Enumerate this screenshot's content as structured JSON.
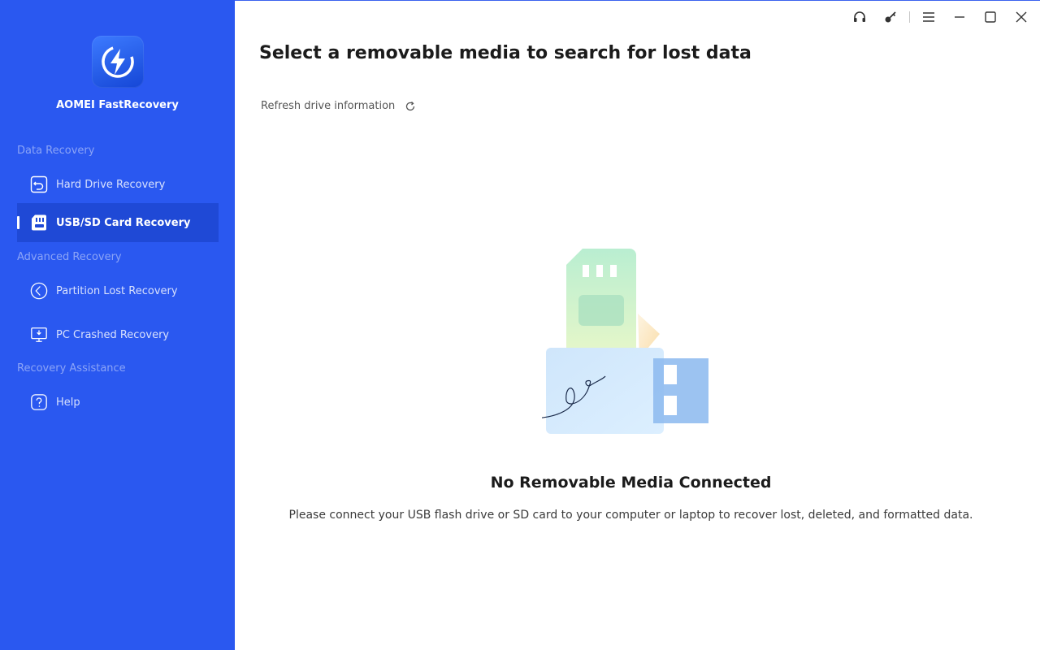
{
  "app": {
    "name": "AOMEI FastRecovery",
    "logo_icon": "lightning-bolt-icon",
    "sidebar_color": "#2a58f0",
    "active_color": "#1f49d6"
  },
  "sidebar": {
    "sections": [
      {
        "label": "Data Recovery",
        "items": [
          {
            "label": "Hard Drive Recovery",
            "icon": "hard-drive-restore-icon",
            "active": false
          },
          {
            "label": "USB/SD Card Recovery",
            "icon": "sd-card-icon",
            "active": true
          }
        ]
      },
      {
        "label": "Advanced Recovery",
        "items": [
          {
            "label": "Partition Lost Recovery",
            "icon": "partition-icon",
            "active": false
          },
          {
            "label": "PC Crashed Recovery",
            "icon": "monitor-crash-icon",
            "active": false
          }
        ]
      },
      {
        "label": "Recovery Assistance",
        "items": [
          {
            "label": "Help",
            "icon": "help-icon",
            "active": false
          }
        ]
      }
    ]
  },
  "titlebar": {
    "buttons": [
      "headset-icon",
      "key-icon",
      "menu-icon",
      "minimize-icon",
      "maximize-icon",
      "close-icon"
    ]
  },
  "main": {
    "title": "Select a removable media to search for lost data",
    "refresh_label": "Refresh drive information",
    "empty_state": {
      "title": "No Removable Media Connected",
      "description": "Please connect your USB flash drive or SD card to your computer or laptop to recover lost, deleted, and formatted data."
    }
  }
}
